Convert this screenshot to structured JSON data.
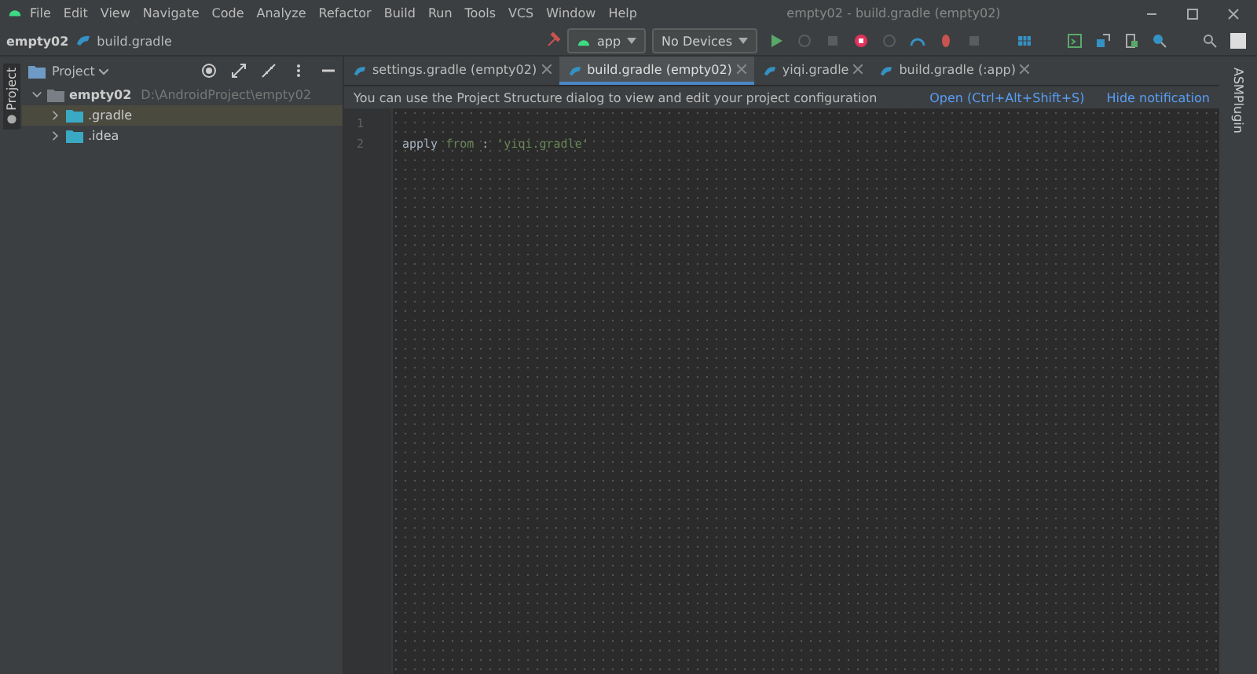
{
  "window": {
    "title": "empty02 - build.gradle (empty02)"
  },
  "menu": [
    "File",
    "Edit",
    "View",
    "Navigate",
    "Code",
    "Analyze",
    "Refactor",
    "Build",
    "Run",
    "Tools",
    "VCS",
    "Window",
    "Help"
  ],
  "breadcrumb": [
    "empty02",
    "build.gradle"
  ],
  "toolbar": {
    "run_config": "app",
    "device": "No Devices"
  },
  "left_stripe": {
    "label": "Project"
  },
  "project_panel": {
    "title": "Project",
    "tree": [
      {
        "name": "empty02",
        "path": "D:\\AndroidProject\\empty02",
        "expanded": true,
        "selected": false,
        "children": [
          {
            "name": ".gradle",
            "expanded": false,
            "selected": true
          },
          {
            "name": ".idea",
            "expanded": false,
            "selected": false
          }
        ]
      }
    ]
  },
  "tabs": [
    {
      "label": "settings.gradle (empty02)",
      "selected": false
    },
    {
      "label": "build.gradle (empty02)",
      "selected": true
    },
    {
      "label": "yiqi.gradle",
      "selected": false
    },
    {
      "label": "build.gradle (:app)",
      "selected": false
    }
  ],
  "notification": {
    "text": "You can use the Project Structure dialog to view and edit your project configuration",
    "actions": [
      "Open (Ctrl+Alt+Shift+S)",
      "Hide notification"
    ]
  },
  "editor": {
    "lines": [
      {
        "number": "1"
      },
      {
        "number": "2",
        "tokens": [
          {
            "kind": "ident",
            "text": "apply"
          },
          {
            "kind": "keyword",
            "text": "from"
          },
          {
            "kind": "plain",
            "text": ":"
          },
          {
            "kind": "string",
            "text": "'yiqi.gradle'"
          }
        ]
      }
    ]
  },
  "right_stripe": {
    "label": "ASMPlugin"
  }
}
